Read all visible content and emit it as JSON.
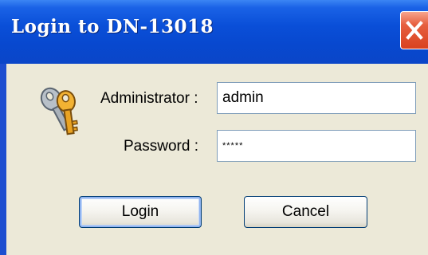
{
  "window": {
    "title": "Login to DN-13018",
    "close_icon": "close-x-icon"
  },
  "form": {
    "icon": "keys-icon",
    "admin_label": "Administrator :",
    "admin_value": "admin",
    "password_label": "Password :",
    "password_value": "*****"
  },
  "buttons": {
    "login_label": "Login",
    "cancel_label": "Cancel"
  },
  "colors": {
    "titlebar": "#0a4fd8",
    "close_button": "#d9421f",
    "client_background": "#ece9d8"
  }
}
